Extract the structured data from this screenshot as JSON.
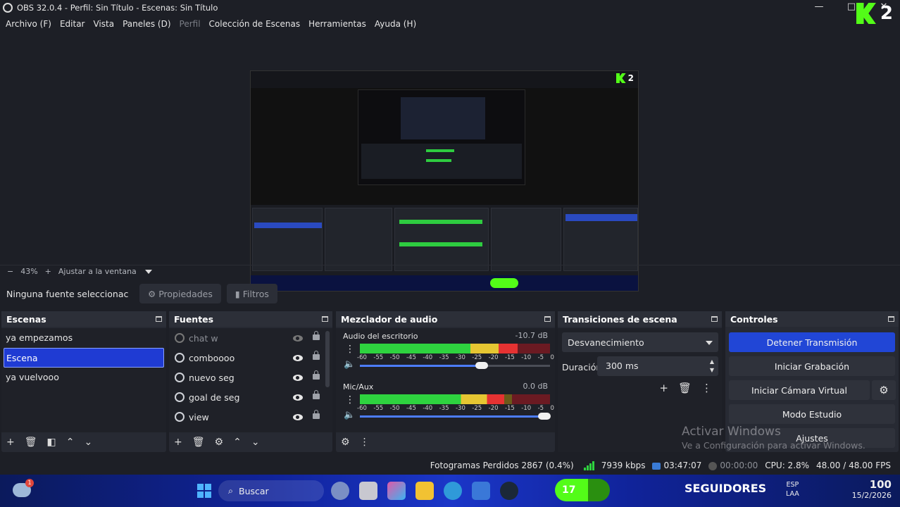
{
  "window": {
    "title": "OBS 32.0.4 - Perfil: Sin Título - Escenas: Sin Título",
    "minimize": "—",
    "close": "✕"
  },
  "menu": [
    "Archivo (F)",
    "Editar",
    "Vista",
    "Paneles (D)",
    "Perfil",
    "Colección de Escenas",
    "Herramientas",
    "Ayuda (H)"
  ],
  "overlay": {
    "kick_number": "2"
  },
  "zoom": {
    "minus": "−",
    "level": "43%",
    "plus": "+",
    "fit": "Ajustar a la ventana"
  },
  "source_bar": {
    "none_selected": "Ninguna fuente seleccionac",
    "properties": "Propiedades",
    "filters": "Filtros"
  },
  "scenes": {
    "title": "Escenas",
    "items": [
      "ya empezamos",
      "Escena",
      "ya vuelvooo"
    ],
    "selected_index": 1
  },
  "sources": {
    "title": "Fuentes",
    "items": [
      {
        "name": "chat w",
        "visible": false
      },
      {
        "name": "comboooo",
        "visible": true
      },
      {
        "name": "nuevo seg",
        "visible": true
      },
      {
        "name": "goal de seg",
        "visible": true
      },
      {
        "name": "view",
        "visible": true
      }
    ]
  },
  "mixer": {
    "title": "Mezclador de audio",
    "ticks": [
      "-60",
      "-55",
      "-50",
      "-45",
      "-40",
      "-35",
      "-30",
      "-25",
      "-20",
      "-15",
      "-10",
      "-5",
      "0"
    ],
    "channels": [
      {
        "name": "Audio del escritorio",
        "db": "-10.7 dB",
        "level": 0.83,
        "volume": 0.64
      },
      {
        "name": "Mic/Aux",
        "db": "0.0 dB",
        "level": 0.76,
        "volume": 0.97
      }
    ]
  },
  "transitions": {
    "title": "Transiciones de escena",
    "selected": "Desvanecimiento",
    "duration_label": "Duración",
    "duration": "300 ms"
  },
  "controls": {
    "title": "Controles",
    "stop_stream": "Detener Transmisión",
    "start_recording": "Iniciar Grabación",
    "virtual_camera": "Iniciar Cámara Virtual",
    "studio_mode": "Modo Estudio",
    "settings": "Ajustes"
  },
  "watermark": {
    "line1": "Activar Windows",
    "line2": "Ve a Configuración para activar Windows."
  },
  "status": {
    "dropped": "Fotogramas Perdidos 2867 (0.4%)",
    "bitrate": "7939 kbps",
    "stream_time": "03:47:07",
    "record_time": "00:00:00",
    "cpu": "CPU: 2.8%",
    "fps": "48.00 / 48.00 FPS"
  },
  "taskbar": {
    "search": "Buscar",
    "weather_badge": "1",
    "followers_count": "17",
    "followers_label": "SEGUIDORES",
    "lang1": "ESP",
    "lang2": "LAA",
    "battery": "100",
    "date": "15/2/2026"
  },
  "colors": {
    "accent": "#2146d6",
    "kick_green": "#53fc18",
    "background": "#1d1f26",
    "dock": "#272a33"
  }
}
